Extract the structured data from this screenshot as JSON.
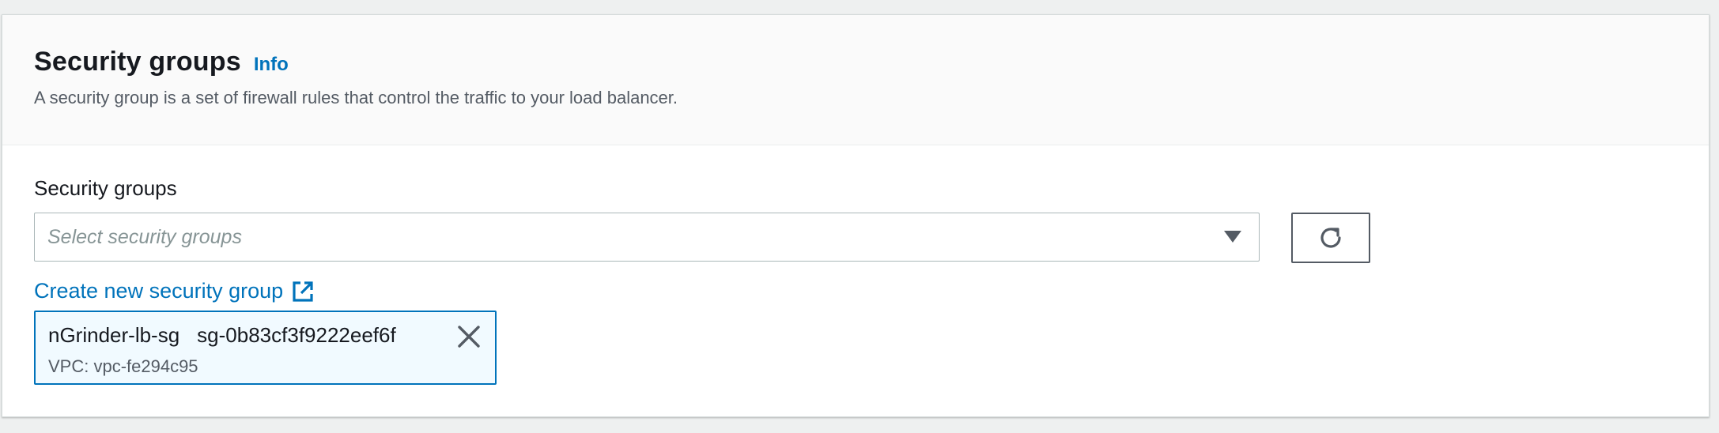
{
  "section": {
    "title": "Security groups",
    "info_label": "Info",
    "description": "A security group is a set of firewall rules that control the traffic to your load balancer."
  },
  "field": {
    "label": "Security groups",
    "placeholder": "Select security groups"
  },
  "create_link": {
    "label": "Create new security group",
    "icon": "external-link-icon"
  },
  "refresh_button": {
    "icon": "refresh-icon"
  },
  "selected_groups": [
    {
      "name": "nGrinder-lb-sg",
      "id": "sg-0b83cf3f9222eef6f",
      "vpc": "VPC: vpc-fe294c95"
    }
  ],
  "colors": {
    "link": "#0073bb",
    "text": "#16191f",
    "muted": "#545b64",
    "token_bg": "#f1faff"
  }
}
